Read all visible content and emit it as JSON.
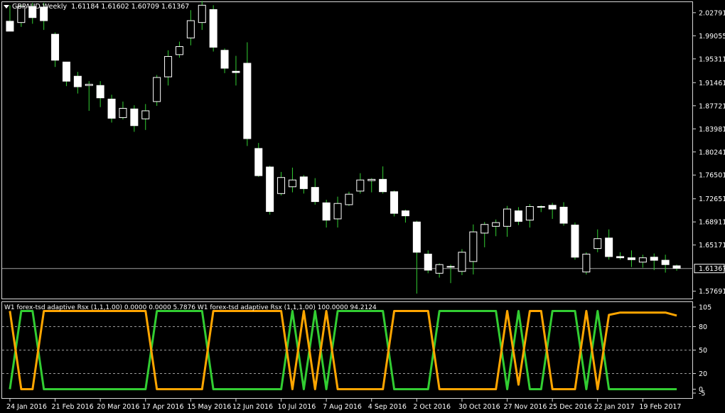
{
  "header": {
    "symbol": "GBPAUD,Weekly",
    "ohlc": "1.61184 1.61602 1.60709 1.61367"
  },
  "indicator": {
    "label": "W1 forex-tsd adaptive Rsx (1,1,1.00) 0.0000 0.0000 5.7876  W1 forex-tsd adaptive Rsx (1,1,1.00) 100.0000 94.2124",
    "levels": [
      "105",
      "80",
      "50",
      "20",
      "0",
      "-5"
    ],
    "colors": {
      "green": "#32cd32",
      "orange": "#ffa500"
    }
  },
  "price_axis": {
    "labels": [
      "2.02791",
      "1.99055",
      "1.95311",
      "1.91461",
      "1.87721",
      "1.83981",
      "1.80241",
      "1.76501",
      "1.72651",
      "1.68911",
      "1.65171",
      "1.57691"
    ],
    "current": "1.61367"
  },
  "time_axis": {
    "labels": [
      "24 Jan 2016",
      "21 Feb 2016",
      "20 Mar 2016",
      "17 Apr 2016",
      "15 May 2016",
      "12 Jun 2016",
      "10 Jul 2016",
      "7 Aug 2016",
      "4 Sep 2016",
      "2 Oct 2016",
      "30 Oct 2016",
      "27 Nov 2016",
      "25 Dec 2016",
      "22 Jan 2017",
      "19 Feb 2017"
    ]
  },
  "chart_data": {
    "type": "candlestick",
    "timeframe": "Weekly",
    "symbol": "GBPAUD",
    "ylim": [
      1.565,
      2.045
    ],
    "candles": [
      {
        "o": 2.014,
        "h": 2.04,
        "l": 2.0,
        "c": 1.998
      },
      {
        "o": 2.012,
        "h": 2.04,
        "l": 2.005,
        "c": 2.038
      },
      {
        "o": 2.038,
        "h": 2.044,
        "l": 2.01,
        "c": 2.02
      },
      {
        "o": 2.037,
        "h": 2.044,
        "l": 2.0,
        "c": 2.015
      },
      {
        "o": 1.993,
        "h": 1.996,
        "l": 1.94,
        "c": 1.951
      },
      {
        "o": 1.948,
        "h": 1.948,
        "l": 1.909,
        "c": 1.917
      },
      {
        "o": 1.925,
        "h": 1.932,
        "l": 1.897,
        "c": 1.908
      },
      {
        "o": 1.91,
        "h": 1.917,
        "l": 1.869,
        "c": 1.912
      },
      {
        "o": 1.91,
        "h": 1.917,
        "l": 1.875,
        "c": 1.89
      },
      {
        "o": 1.888,
        "h": 1.895,
        "l": 1.85,
        "c": 1.857
      },
      {
        "o": 1.858,
        "h": 1.884,
        "l": 1.855,
        "c": 1.873
      },
      {
        "o": 1.872,
        "h": 1.878,
        "l": 1.835,
        "c": 1.845
      },
      {
        "o": 1.856,
        "h": 1.88,
        "l": 1.838,
        "c": 1.869
      },
      {
        "o": 1.884,
        "h": 1.927,
        "l": 1.877,
        "c": 1.923
      },
      {
        "o": 1.924,
        "h": 1.967,
        "l": 1.91,
        "c": 1.957
      },
      {
        "o": 1.96,
        "h": 1.981,
        "l": 1.955,
        "c": 1.973
      },
      {
        "o": 1.987,
        "h": 2.032,
        "l": 1.975,
        "c": 2.015
      },
      {
        "o": 2.012,
        "h": 2.047,
        "l": 2.0,
        "c": 2.04
      },
      {
        "o": 2.033,
        "h": 2.04,
        "l": 1.965,
        "c": 1.972
      },
      {
        "o": 1.967,
        "h": 1.97,
        "l": 1.93,
        "c": 1.938
      },
      {
        "o": 1.933,
        "h": 1.958,
        "l": 1.91,
        "c": 1.931
      },
      {
        "o": 1.946,
        "h": 1.98,
        "l": 1.812,
        "c": 1.824
      },
      {
        "o": 1.808,
        "h": 1.817,
        "l": 1.762,
        "c": 1.764
      },
      {
        "o": 1.778,
        "h": 1.78,
        "l": 1.701,
        "c": 1.706
      },
      {
        "o": 1.735,
        "h": 1.77,
        "l": 1.732,
        "c": 1.761
      },
      {
        "o": 1.746,
        "h": 1.777,
        "l": 1.737,
        "c": 1.757
      },
      {
        "o": 1.762,
        "h": 1.765,
        "l": 1.735,
        "c": 1.743
      },
      {
        "o": 1.745,
        "h": 1.76,
        "l": 1.717,
        "c": 1.722
      },
      {
        "o": 1.72,
        "h": 1.725,
        "l": 1.68,
        "c": 1.692
      },
      {
        "o": 1.694,
        "h": 1.73,
        "l": 1.68,
        "c": 1.719
      },
      {
        "o": 1.717,
        "h": 1.738,
        "l": 1.715,
        "c": 1.734
      },
      {
        "o": 1.739,
        "h": 1.768,
        "l": 1.735,
        "c": 1.757
      },
      {
        "o": 1.756,
        "h": 1.76,
        "l": 1.737,
        "c": 1.758
      },
      {
        "o": 1.758,
        "h": 1.779,
        "l": 1.735,
        "c": 1.738
      },
      {
        "o": 1.738,
        "h": 1.74,
        "l": 1.698,
        "c": 1.703
      },
      {
        "o": 1.707,
        "h": 1.709,
        "l": 1.688,
        "c": 1.699
      },
      {
        "o": 1.689,
        "h": 1.691,
        "l": 1.573,
        "c": 1.64
      },
      {
        "o": 1.637,
        "h": 1.643,
        "l": 1.606,
        "c": 1.611
      },
      {
        "o": 1.606,
        "h": 1.622,
        "l": 1.599,
        "c": 1.62
      },
      {
        "o": 1.616,
        "h": 1.62,
        "l": 1.59,
        "c": 1.617
      },
      {
        "o": 1.609,
        "h": 1.645,
        "l": 1.603,
        "c": 1.64
      },
      {
        "o": 1.625,
        "h": 1.685,
        "l": 1.604,
        "c": 1.673
      },
      {
        "o": 1.671,
        "h": 1.689,
        "l": 1.648,
        "c": 1.685
      },
      {
        "o": 1.682,
        "h": 1.693,
        "l": 1.666,
        "c": 1.688
      },
      {
        "o": 1.682,
        "h": 1.715,
        "l": 1.665,
        "c": 1.71
      },
      {
        "o": 1.707,
        "h": 1.713,
        "l": 1.684,
        "c": 1.69
      },
      {
        "o": 1.692,
        "h": 1.718,
        "l": 1.68,
        "c": 1.714
      },
      {
        "o": 1.714,
        "h": 1.716,
        "l": 1.705,
        "c": 1.713
      },
      {
        "o": 1.716,
        "h": 1.72,
        "l": 1.694,
        "c": 1.71
      },
      {
        "o": 1.713,
        "h": 1.721,
        "l": 1.683,
        "c": 1.687
      },
      {
        "o": 1.684,
        "h": 1.688,
        "l": 1.628,
        "c": 1.632
      },
      {
        "o": 1.608,
        "h": 1.64,
        "l": 1.604,
        "c": 1.637
      },
      {
        "o": 1.646,
        "h": 1.677,
        "l": 1.64,
        "c": 1.662
      },
      {
        "o": 1.663,
        "h": 1.677,
        "l": 1.628,
        "c": 1.633
      },
      {
        "o": 1.633,
        "h": 1.64,
        "l": 1.628,
        "c": 1.631
      },
      {
        "o": 1.631,
        "h": 1.643,
        "l": 1.616,
        "c": 1.628
      },
      {
        "o": 1.624,
        "h": 1.636,
        "l": 1.615,
        "c": 1.631
      },
      {
        "o": 1.632,
        "h": 1.638,
        "l": 1.611,
        "c": 1.627
      },
      {
        "o": 1.627,
        "h": 1.636,
        "l": 1.607,
        "c": 1.62
      },
      {
        "o": 1.618,
        "h": 1.62,
        "l": 1.61,
        "c": 1.614
      }
    ],
    "last_price": 1.61367,
    "indicator_ylim": [
      -5,
      105
    ],
    "indicator_levels": [
      80,
      50,
      20
    ],
    "series": [
      {
        "name": "W1 forex-tsd adaptive Rsx (1,1,1.00)",
        "color": "#32cd32",
        "values": [
          0,
          100,
          100,
          0,
          0,
          0,
          0,
          0,
          0,
          0,
          0,
          0,
          0,
          100,
          100,
          100,
          100,
          100,
          0,
          0,
          0,
          0,
          0,
          0,
          0,
          100,
          0,
          100,
          0,
          100,
          100,
          100,
          100,
          100,
          0,
          0,
          0,
          0,
          100,
          100,
          100,
          100,
          100,
          100,
          0,
          100,
          0,
          0,
          100,
          100,
          100,
          0,
          100,
          0,
          0,
          0,
          0,
          0,
          0,
          0
        ]
      },
      {
        "name": "W1 forex-tsd adaptive Rsx (1,1,1.00)",
        "color": "#ffa500",
        "values": [
          100,
          0,
          0,
          100,
          100,
          100,
          100,
          100,
          100,
          100,
          100,
          100,
          100,
          0,
          0,
          0,
          0,
          0,
          100,
          100,
          100,
          100,
          100,
          100,
          100,
          0,
          100,
          0,
          100,
          0,
          0,
          0,
          0,
          0,
          100,
          100,
          100,
          100,
          0,
          0,
          0,
          0,
          0,
          0,
          100,
          5.8,
          100,
          100,
          0,
          0,
          0,
          100,
          0,
          95,
          98,
          98,
          98,
          98,
          98,
          94.2
        ]
      }
    ]
  }
}
